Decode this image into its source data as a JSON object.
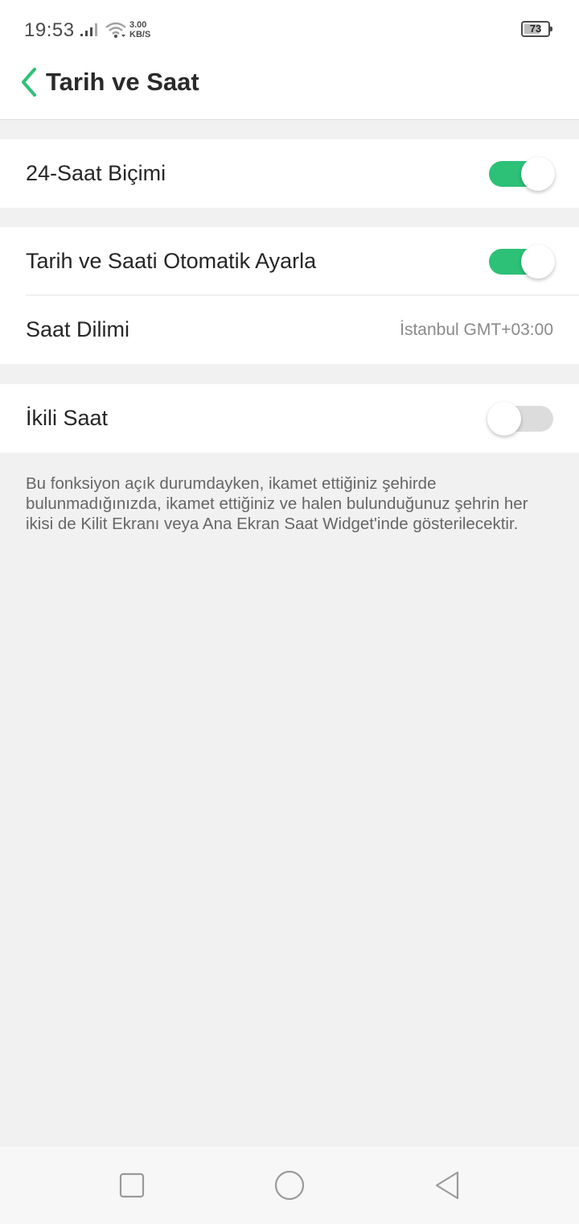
{
  "status_bar": {
    "time": "19:53",
    "speed_value": "3.00",
    "speed_unit": "KB/S",
    "battery": "73",
    "battery_level": 0.73
  },
  "header": {
    "title": "Tarih ve Saat"
  },
  "settings": {
    "hour_format": {
      "label": "24-Saat Biçimi",
      "enabled": true
    },
    "auto_datetime": {
      "label": "Tarih ve Saati Otomatik Ayarla",
      "enabled": true
    },
    "timezone": {
      "label": "Saat Dilimi",
      "value": "İstanbul GMT+03:00"
    },
    "dual_clock": {
      "label": "İkili Saat",
      "enabled": false
    }
  },
  "dual_clock_description": "Bu fonksiyon açık durumdayken, ikamet ettiğiniz şehirde bulunmadığınızda, ikamet ettiğiniz ve halen bulunduğunuz şehrin her ikisi de Kilit Ekranı veya Ana Ekran Saat Widget'inde gösterilecektir.",
  "colors": {
    "accent": "#2cc177",
    "background": "#f1f1f1",
    "toggle_off": "#dcdcdc"
  },
  "icons": {
    "back": "chevron-left-icon",
    "signal": "cell-signal-icon",
    "wifi": "wifi-icon",
    "battery": "battery-icon",
    "nav_recent": "square-icon",
    "nav_home": "circle-icon",
    "nav_back": "triangle-back-icon"
  }
}
